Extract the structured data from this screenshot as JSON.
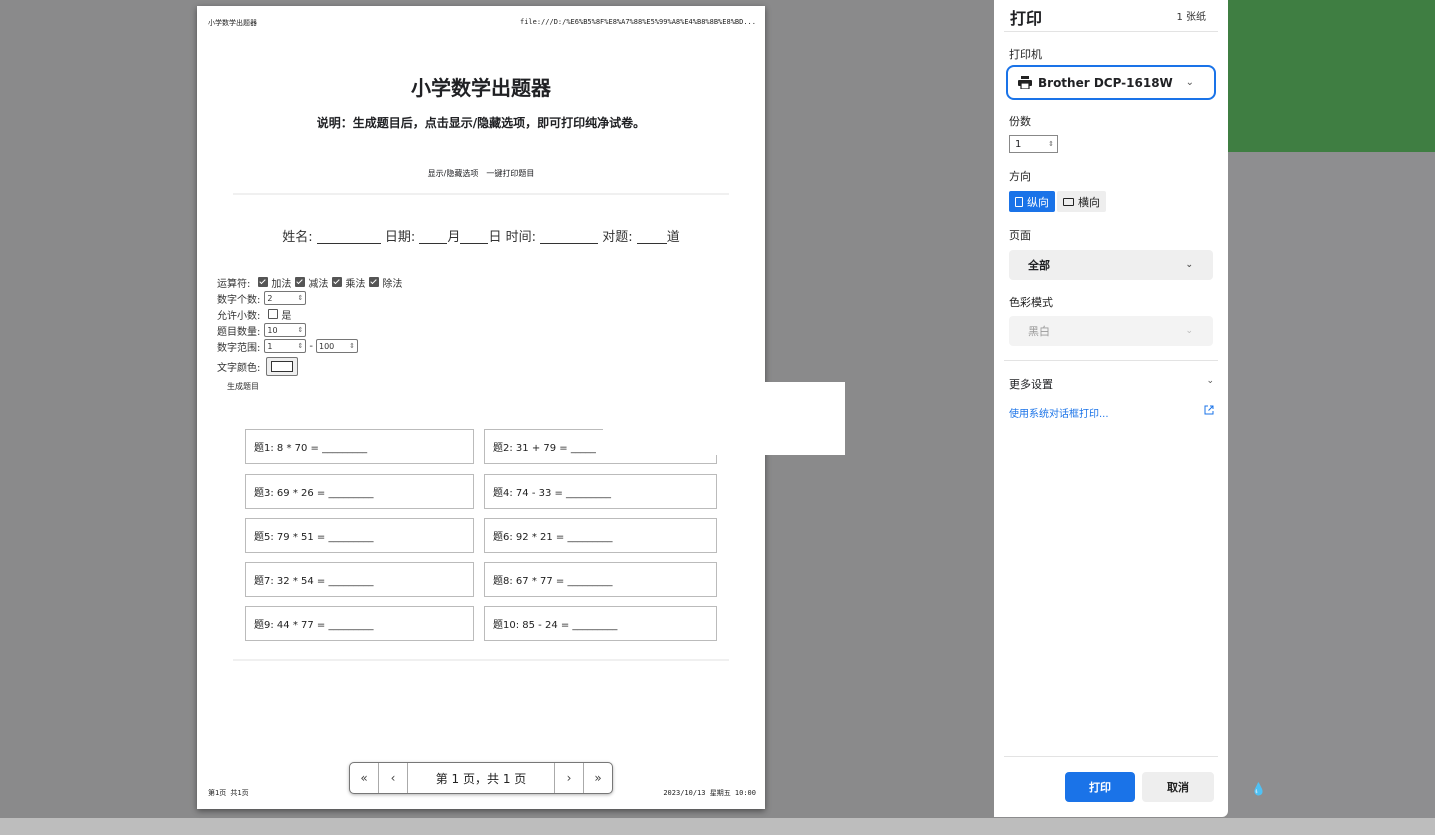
{
  "page": {
    "header_left": "小学数学出题器",
    "header_right": "file:///D:/%E6%B5%8F%E8%A7%88%E5%99%A8%E4%B8%8B%E8%BD...",
    "footer_left": "第1页 共1页",
    "footer_right": "2023/10/13 星期五 10:00",
    "title": "小学数学出题器",
    "subtitle": "说明：生成题目后，点击显示/隐藏选项，即可打印纯净试卷。",
    "toggle_link": "显示/隐藏选项",
    "print_link": "一键打印题目",
    "info": {
      "name": "姓名:",
      "date": "日期:",
      "month": "月",
      "day_time": "日 时间:",
      "correct": "对题:",
      "unit": "道"
    },
    "options": {
      "operator_label": "运算符:",
      "ops": [
        "加法",
        "减法",
        "乘法",
        "除法"
      ],
      "count_label": "数字个数:",
      "count_value": "2",
      "decimal_label": "允许小数:",
      "decimal_text": "是",
      "qty_label": "题目数量:",
      "qty_value": "10",
      "range_label": "数字范围:",
      "range_min": "1",
      "range_dash": "-",
      "range_max": "100",
      "color_label": "文字颜色:",
      "generate": "生成题目"
    },
    "questions": [
      "题1: 8 * 70 = _________",
      "题2: 31 + 79 = _____",
      "题3: 69 * 26 = _________",
      "题4: 74 - 33 = _________",
      "题5: 79 * 51 = _________",
      "题6: 92 * 21 = _________",
      "题7: 32 * 54 = _________",
      "题8: 67 * 77 = _________",
      "题9: 44 * 77 = _________",
      "题10: 85 - 24 = _________"
    ]
  },
  "pager": {
    "first": "«",
    "prev": "‹",
    "label": "第 1 页，共 1 页",
    "next": "›",
    "last": "»"
  },
  "panel": {
    "title": "打印",
    "sheets": "1 张纸",
    "printer_label": "打印机",
    "printer_name": "Brother DCP-1618W",
    "copies_label": "份数",
    "copies_value": "1",
    "orientation_label": "方向",
    "portrait": "纵向",
    "landscape": "横向",
    "pages_label": "页面",
    "pages_value": "全部",
    "color_label": "色彩模式",
    "color_value": "黑白",
    "more_settings": "更多设置",
    "system_dialog": "使用系统对话框打印...",
    "print_button": "打印",
    "cancel_button": "取消",
    "accent": "#1a73e8"
  }
}
